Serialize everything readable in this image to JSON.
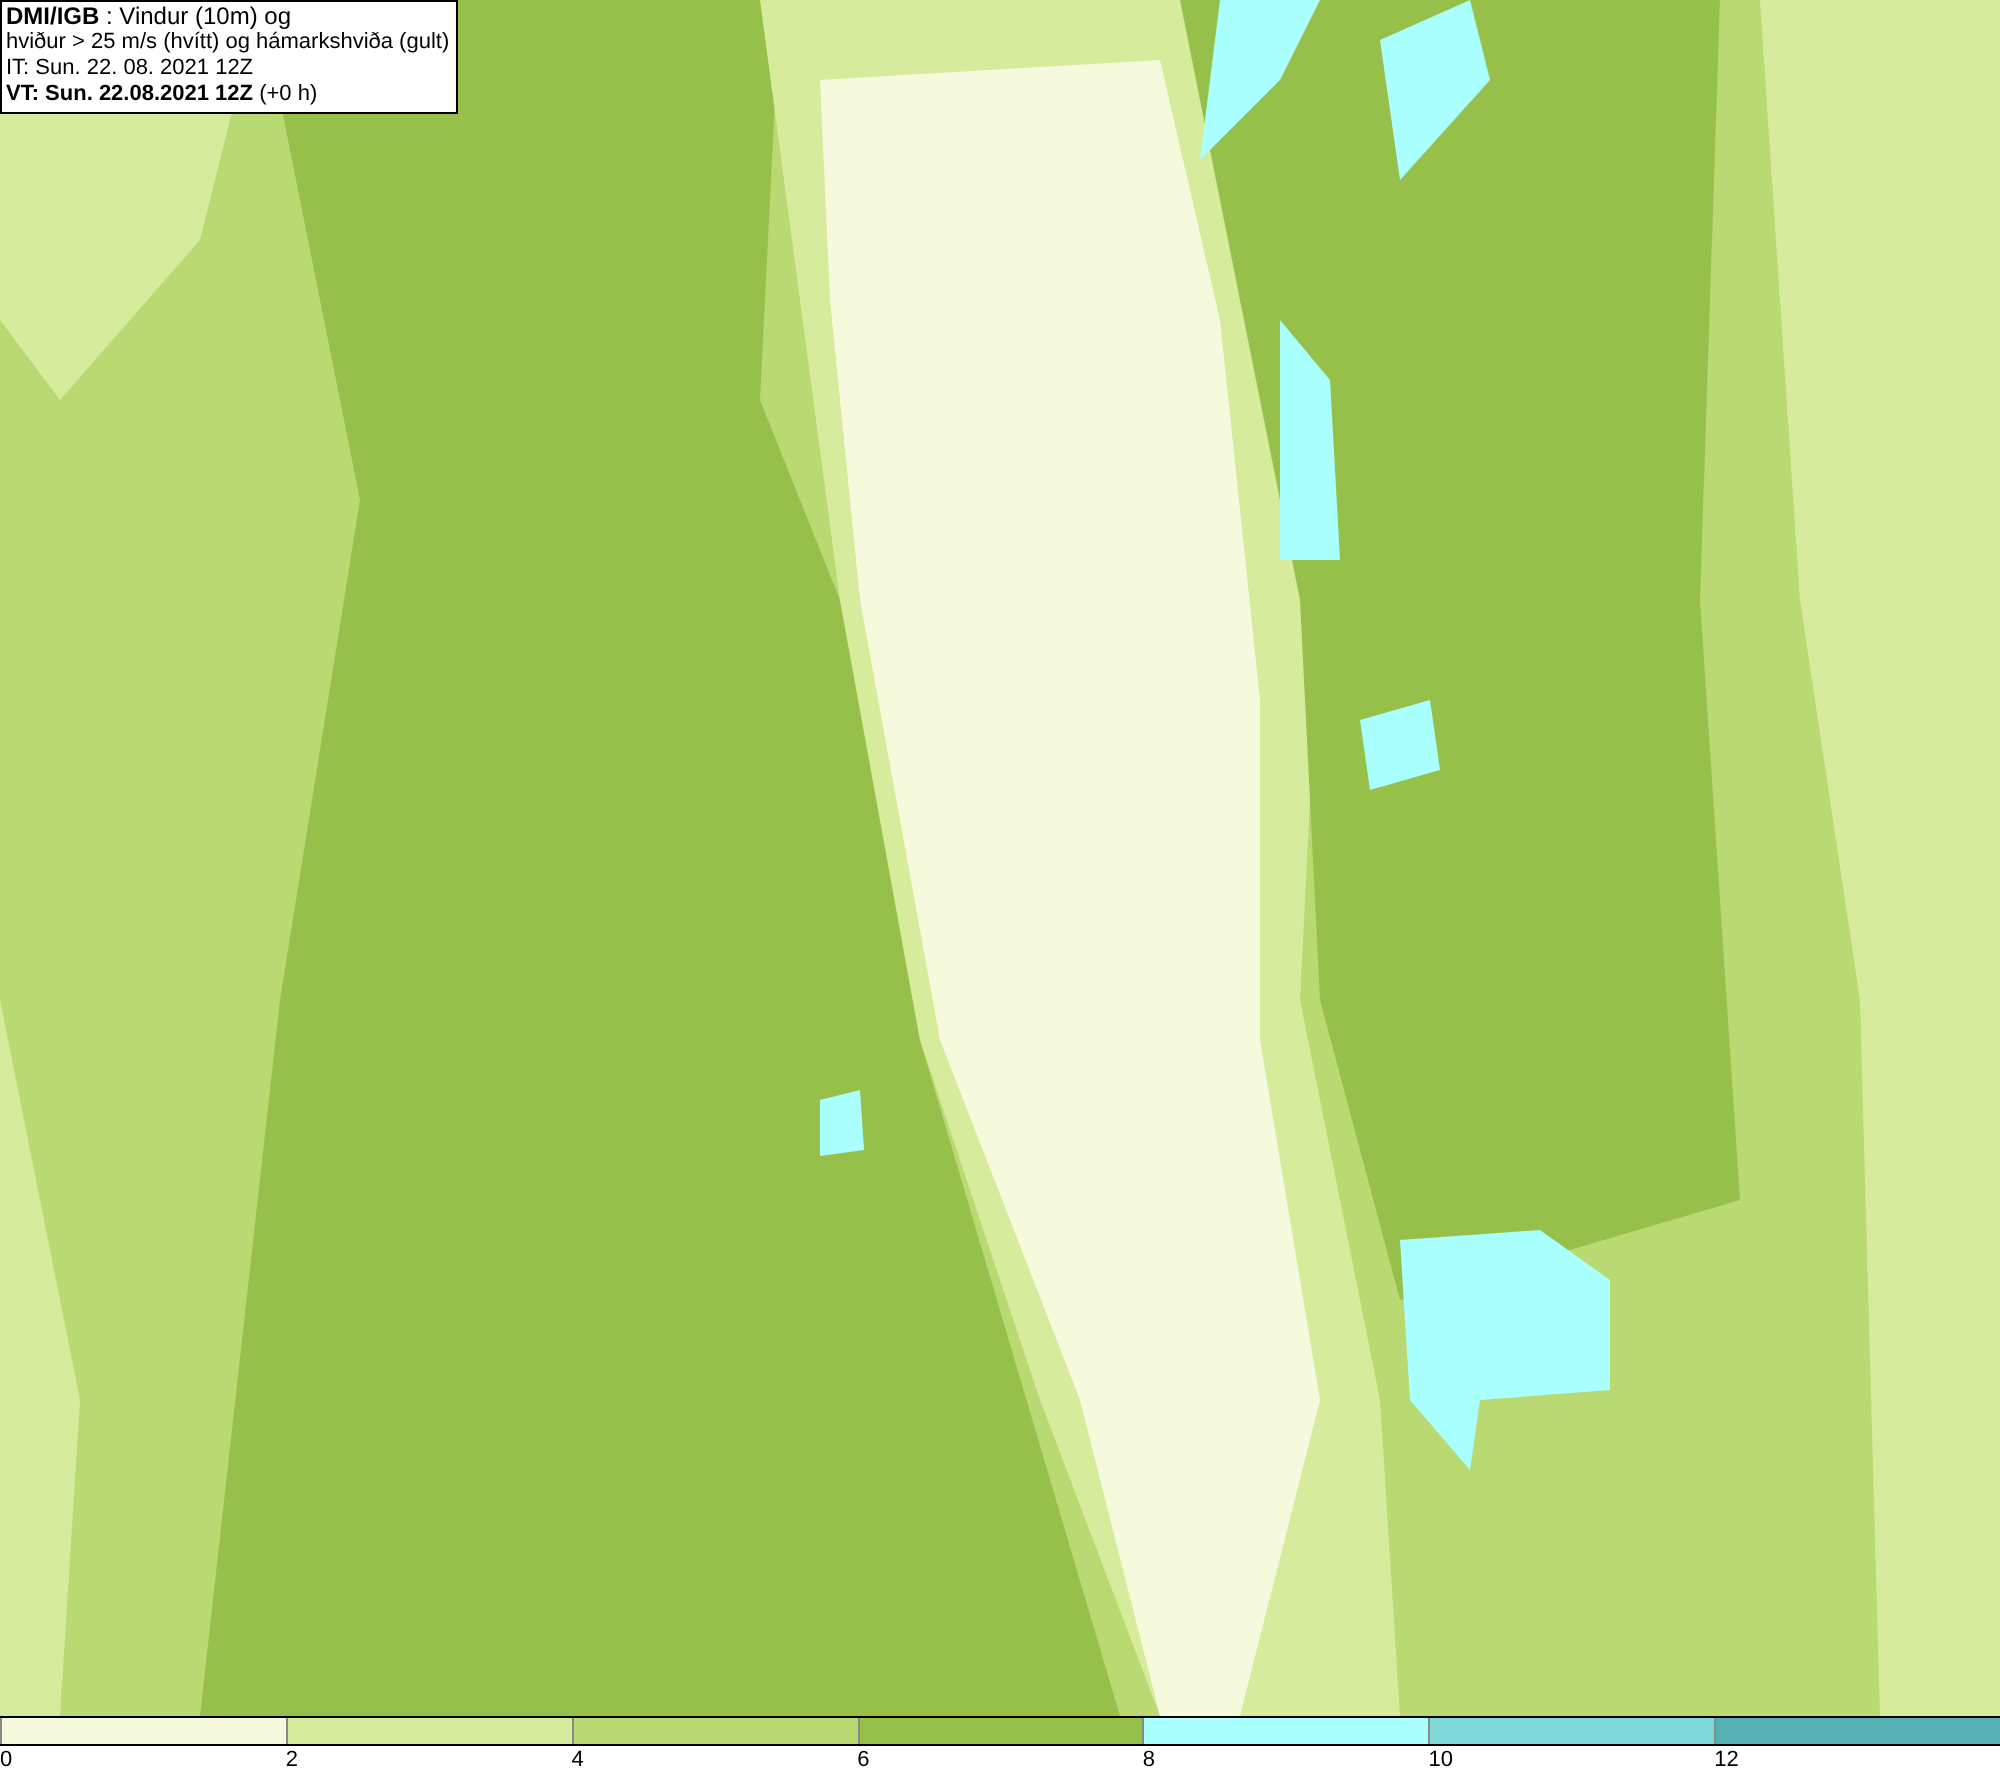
{
  "header": {
    "lines": [
      "**DMI/IGB** : Vindur (10m) og",
      "hviður > 25 m/s (hvítt) og hámarkshviða (gult)",
      "IT: Sun. 22. 08. 2021 12Z",
      "**VT: Sun. 22.08.2021 12Z** (+0 h)"
    ]
  },
  "legend": [
    {
      "label": "0",
      "color": "#f5fadc"
    },
    {
      "label": "2",
      "color": "#d6ec9c"
    },
    {
      "label": "4",
      "color": "#b9da72"
    },
    {
      "label": "6",
      "color": "#96c04a"
    },
    {
      "label": "8",
      "color": "#aaffff"
    },
    {
      "label": "10",
      "color": "#80d9d9"
    },
    {
      "label": "12",
      "color": "#56b1b4"
    }
  ]
}
